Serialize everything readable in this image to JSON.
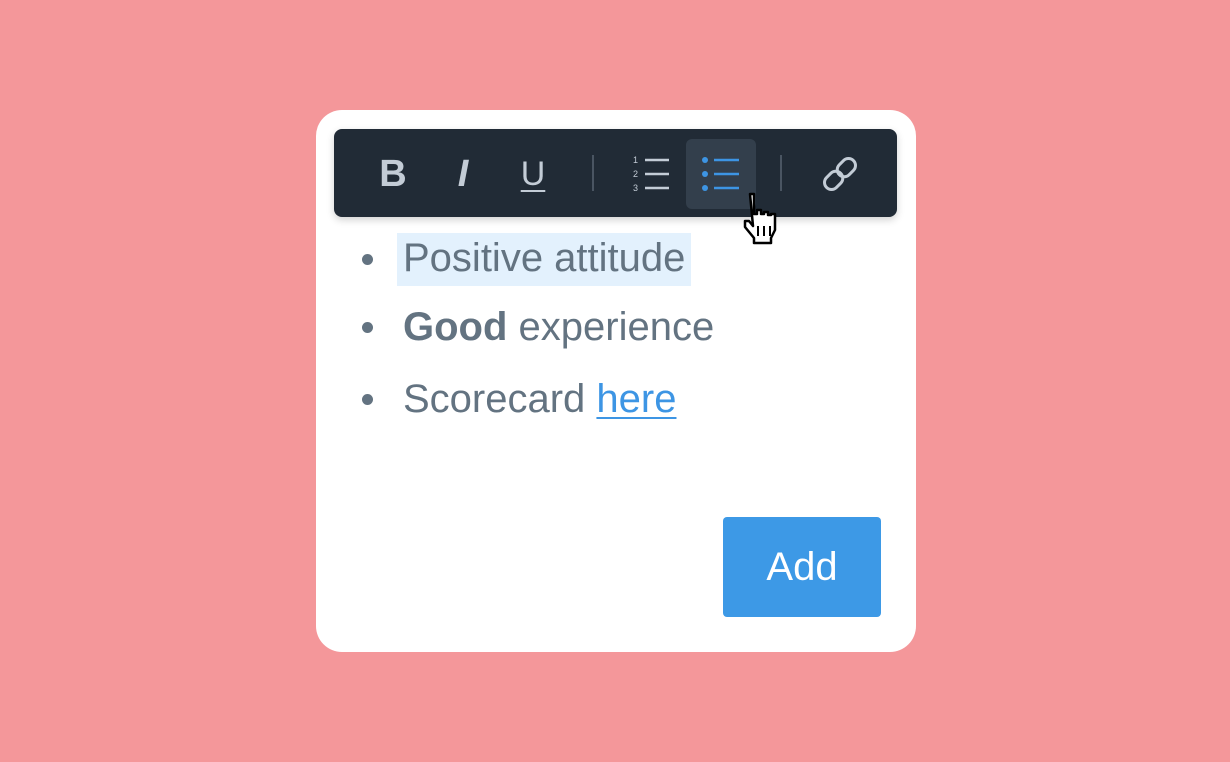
{
  "toolbar": {
    "bold_label": "B",
    "italic_label": "I",
    "underline_label": "U",
    "ordered_list_icon": "ordered-list-icon",
    "ordered_list_numbers": [
      "1",
      "2",
      "3"
    ],
    "bullet_list_icon": "bullet-list-icon",
    "link_icon": "link-icon",
    "active_button": "bullet-list"
  },
  "editor": {
    "items": [
      {
        "text": "Positive attitude",
        "selected": true
      },
      {
        "bold_part": "Good",
        "rest": " experience"
      },
      {
        "text": "Scorecard ",
        "link_text": "here"
      }
    ]
  },
  "actions": {
    "add_label": "Add"
  },
  "colors": {
    "background": "#f4979a",
    "toolbar": "#212b36",
    "active_icon": "#3d95e4",
    "primary_button": "#3d99e6",
    "text": "#637381",
    "selection": "#e3f1fd"
  }
}
